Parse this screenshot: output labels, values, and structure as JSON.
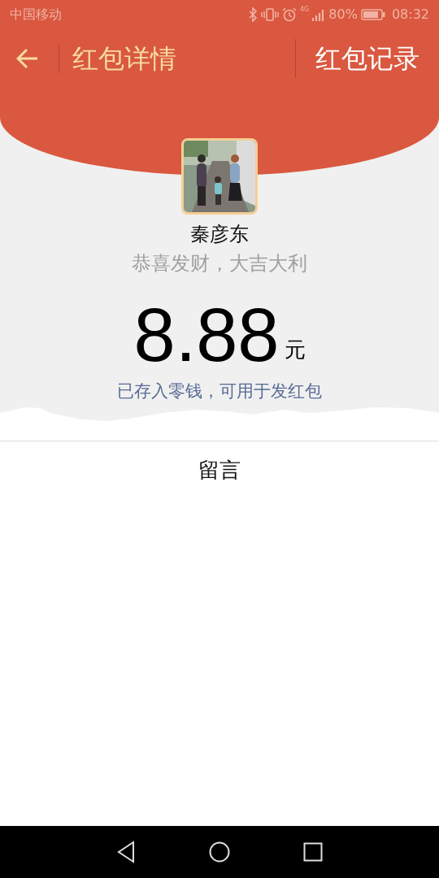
{
  "status_bar": {
    "carrier": "中国移动",
    "network": "4G",
    "battery": "80%",
    "time": "08:32"
  },
  "header": {
    "title": "红包详情",
    "action": "红包记录"
  },
  "sender": {
    "name": "秦彦东",
    "greeting": "恭喜发财，大吉大利"
  },
  "amount": {
    "value": "8.88",
    "unit": "元",
    "note": "已存入零钱，可用于发红包"
  },
  "message_section": {
    "title": "留言"
  }
}
